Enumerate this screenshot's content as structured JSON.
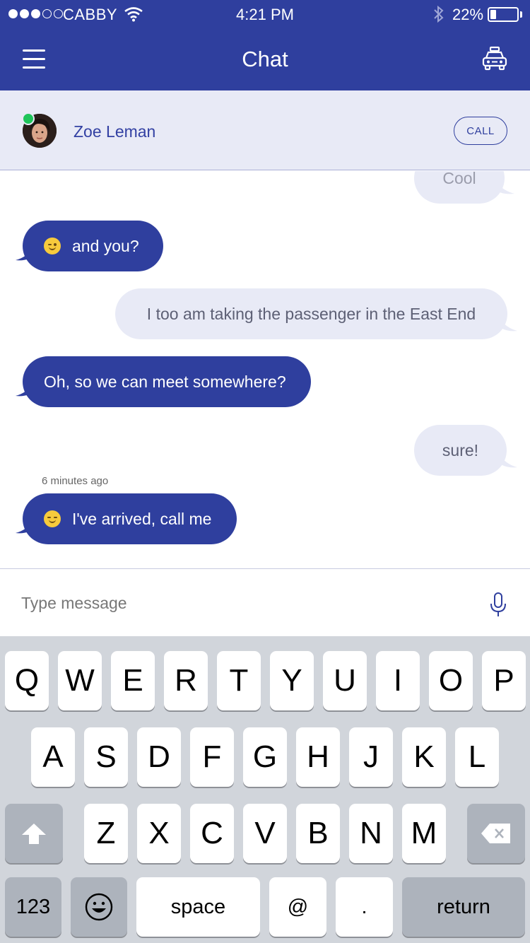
{
  "status": {
    "carrier": "CABBY",
    "time": "4:21 PM",
    "battery": "22%",
    "battery_level": 0.22
  },
  "nav": {
    "title": "Chat",
    "menu_icon": "hamburger-menu-icon",
    "taxi_icon": "taxi-icon"
  },
  "contact": {
    "name": "Zoe Leman",
    "online": true,
    "call_label": "CALL"
  },
  "messages": [
    {
      "dir": "out",
      "text": "Cool"
    },
    {
      "dir": "in",
      "text": "and you?",
      "emoji": "winking-face"
    },
    {
      "dir": "out",
      "text": "I too am taking the passenger in the East End"
    },
    {
      "dir": "in",
      "text": "Oh, so we can meet somewhere?"
    },
    {
      "dir": "out",
      "text": "sure!"
    },
    {
      "dir": "in",
      "text": "I've arrived, call me",
      "emoji": "relieved-face",
      "time": "6 minutes ago"
    }
  ],
  "input": {
    "placeholder": "Type message",
    "mic_icon": "microphone-icon"
  },
  "keyboard": {
    "row1": [
      "Q",
      "W",
      "E",
      "R",
      "T",
      "Y",
      "U",
      "I",
      "O",
      "P"
    ],
    "row2": [
      "A",
      "S",
      "D",
      "F",
      "G",
      "H",
      "J",
      "K",
      "L"
    ],
    "row3": [
      "Z",
      "X",
      "C",
      "V",
      "B",
      "N",
      "M"
    ],
    "numbers": "123",
    "space": "space",
    "at": "@",
    "period": ".",
    "return": "return"
  },
  "colors": {
    "primary": "#2f3f9e",
    "bubble_out": "#e8eaf6",
    "online": "#1fc55a"
  }
}
